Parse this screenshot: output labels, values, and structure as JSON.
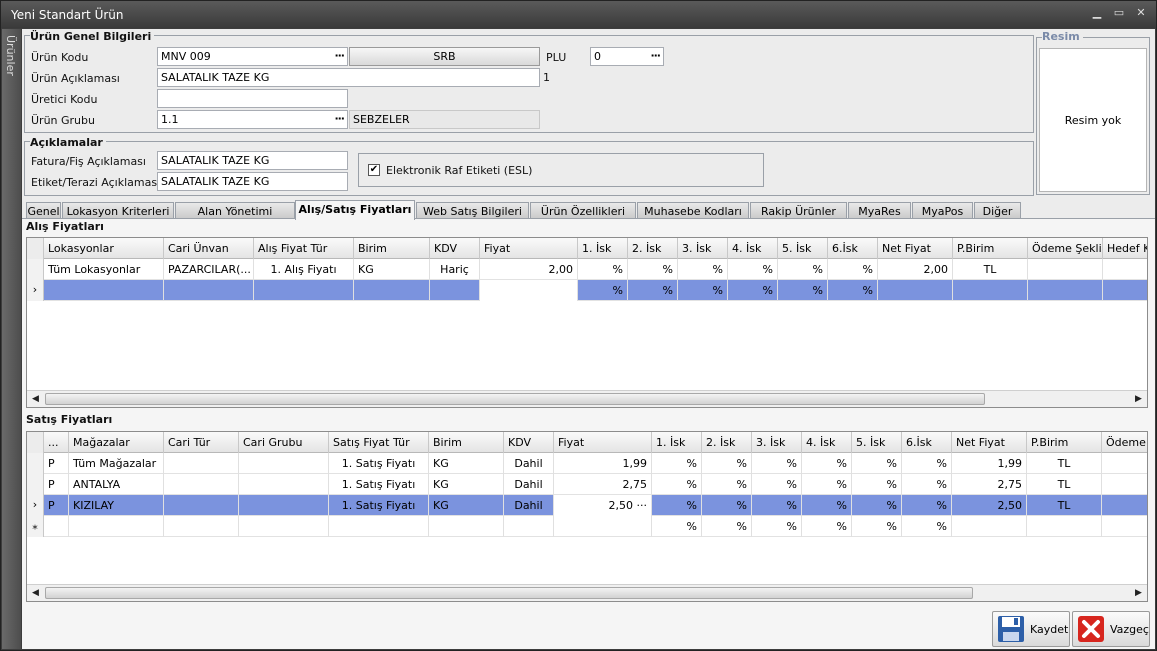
{
  "window": {
    "title": "Yeni Standart Ürün",
    "side_tab": "Ürünler"
  },
  "genel": {
    "title": "Ürün Genel Bilgileri",
    "urun_kodu_label": "Ürün Kodu",
    "urun_kodu": "MNV 009",
    "srb_button": "SRB",
    "plu_label": "PLU",
    "plu": "0",
    "aciklama_label": "Ürün Açıklaması",
    "aciklama": "SALATALIK TAZE KG",
    "aciklama_suffix": "1",
    "uretici_label": "Üretici Kodu",
    "uretici": "",
    "grup_label": "Ürün Grubu",
    "grup": "1.1",
    "grup_adi": "SEBZELER"
  },
  "resim": {
    "title": "Resim",
    "placeholder": "Resim yok"
  },
  "aciklamalar": {
    "title": "Açıklamalar",
    "fatura_label": "Fatura/Fiş Açıklaması",
    "fatura": "SALATALIK TAZE KG",
    "etiket_label": "Etiket/Terazi Açıklaması",
    "etiket": "SALATALIK TAZE KG",
    "esl_label": "Elektronik Raf Etiketi (ESL)",
    "esl_checked": true
  },
  "tabs": [
    "Genel",
    "Lokasyon Kriterleri",
    "Alan Yönetimi",
    "Alış/Satış Fiyatları",
    "Web Satış Bilgileri",
    "Ürün Özellikleri",
    "Muhasebe Kodları",
    "Rakip Ürünler",
    "MyaRes",
    "MyaPos",
    "Diğer"
  ],
  "active_tab": "Alış/Satış Fiyatları",
  "alis": {
    "title": "Alış Fiyatları",
    "columns": [
      "Lokasyonlar",
      "Cari Ünvan",
      "Alış Fiyat Tür",
      "Birim",
      "KDV",
      "Fiyat",
      "1. İsk",
      "2. İsk",
      "3. İsk",
      "4. İsk",
      "5. İsk",
      "6.İsk",
      "Net Fiyat",
      "P.Birim",
      "Ödeme Şekli",
      "Hedef K"
    ],
    "rows": [
      [
        "Tüm Lokasyonlar",
        "PAZARCILAR(...",
        "1. Alış Fiyatı",
        "KG",
        "Hariç",
        "2,00",
        "%",
        "%",
        "%",
        "%",
        "%",
        "%",
        "2,00",
        "TL",
        "",
        ""
      ],
      [
        "",
        "",
        "",
        "",
        "",
        "",
        "%",
        "%",
        "%",
        "%",
        "%",
        "%",
        "",
        "",
        "",
        ""
      ]
    ]
  },
  "satis": {
    "title": "Satış Fiyatları",
    "columns": [
      "...",
      "Mağazalar",
      "Cari Tür",
      "Cari Grubu",
      "Satış Fiyat Tür",
      "Birim",
      "KDV",
      "Fiyat",
      "1. İsk",
      "2. İsk",
      "3. İsk",
      "4. İsk",
      "5. İsk",
      "6.İsk",
      "Net Fiyat",
      "P.Birim",
      "Ödeme Ş"
    ],
    "rows": [
      [
        "P",
        "Tüm Mağazalar",
        "",
        "",
        "1. Satış Fiyatı",
        "KG",
        "Dahil",
        "1,99",
        "%",
        "%",
        "%",
        "%",
        "%",
        "%",
        "1,99",
        "TL",
        ""
      ],
      [
        "P",
        "ANTALYA",
        "",
        "",
        "1. Satış Fiyatı",
        "KG",
        "Dahil",
        "2,75",
        "%",
        "%",
        "%",
        "%",
        "%",
        "%",
        "2,75",
        "TL",
        ""
      ],
      [
        "P",
        "KIZILAY",
        "",
        "",
        "1. Satış Fiyatı",
        "KG",
        "Dahil",
        "2,50 ···",
        "%",
        "%",
        "%",
        "%",
        "%",
        "%",
        "2,50",
        "TL",
        ""
      ],
      [
        "",
        "",
        "",
        "",
        "",
        "",
        "",
        "",
        "%",
        "%",
        "%",
        "%",
        "%",
        "%",
        "",
        "",
        ""
      ]
    ]
  },
  "buttons": {
    "kaydet": "Kaydet",
    "vazgec": "Vazgeç"
  }
}
